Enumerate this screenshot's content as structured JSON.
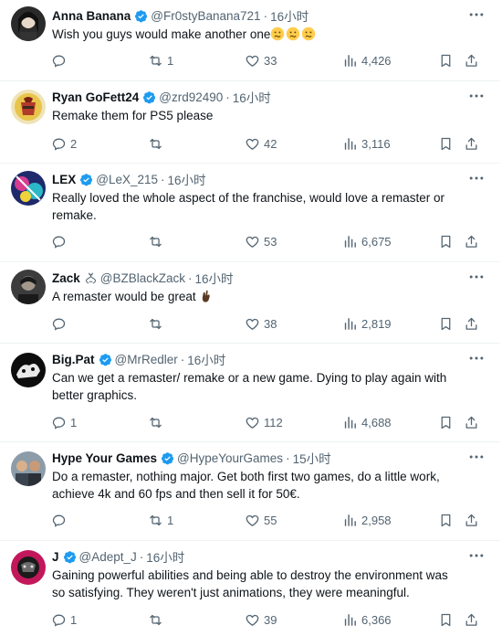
{
  "colors": {
    "verified": "#1d9bf0",
    "text": "#0f1419",
    "muted": "#536471",
    "divider": "#eff3f4"
  },
  "separator": "·",
  "tweets": [
    {
      "name": "Anna Banana",
      "handle": "@Fr0styBanana721",
      "time": "16小时",
      "verified": true,
      "text_lines": [
        "Wish you guys would make another one"
      ],
      "emojis": [
        "confused-face",
        "confused-face",
        "confused-face"
      ],
      "replies": "",
      "retweets": "1",
      "likes": "33",
      "views": "4,426"
    },
    {
      "name": "Ryan GoFett24",
      "handle": "@zrd92490",
      "time": "16小时",
      "verified": true,
      "text_lines": [
        "Remake them for PS5 please"
      ],
      "replies": "2",
      "retweets": "",
      "likes": "42",
      "views": "3,116"
    },
    {
      "name": "LEX",
      "handle": "@LeX_215",
      "time": "16小时",
      "verified": true,
      "text_lines": [
        "Really loved the whole aspect of the franchise, would love a remaster or",
        "remake."
      ],
      "replies": "",
      "retweets": "",
      "likes": "53",
      "views": "6,675"
    },
    {
      "name": "Zack",
      "handle": "@BZBlackZack",
      "time": "16小时",
      "verified": false,
      "text_lines": [
        "A remaster would be great"
      ],
      "replies": "",
      "retweets": "",
      "likes": "38",
      "views": "2,819"
    },
    {
      "name": "Big.Pat",
      "handle": "@MrRedler",
      "time": "16小时",
      "verified": true,
      "text_lines": [
        "Can we get a remaster/ remake or a new game. Dying to play again with",
        "better graphics."
      ],
      "replies": "1",
      "retweets": "",
      "likes": "112",
      "views": "4,688"
    },
    {
      "name": "Hype Your Games",
      "handle": "@HypeYourGames",
      "time": "15小时",
      "verified": true,
      "text_lines": [
        "Do a remaster, nothing major. Get both first two games, do a little work,",
        "achieve 4k and 60 fps and then sell it for 50€."
      ],
      "replies": "",
      "retweets": "1",
      "likes": "55",
      "views": "2,958"
    },
    {
      "name": "J",
      "handle": "@Adept_J",
      "time": "16小时",
      "verified": true,
      "text_lines": [
        "Gaining powerful abilities and being able to destroy the environment was",
        "so satisfying. They weren't just animations, they were meaningful."
      ],
      "replies": "1",
      "retweets": "",
      "likes": "39",
      "views": "6,366"
    }
  ]
}
